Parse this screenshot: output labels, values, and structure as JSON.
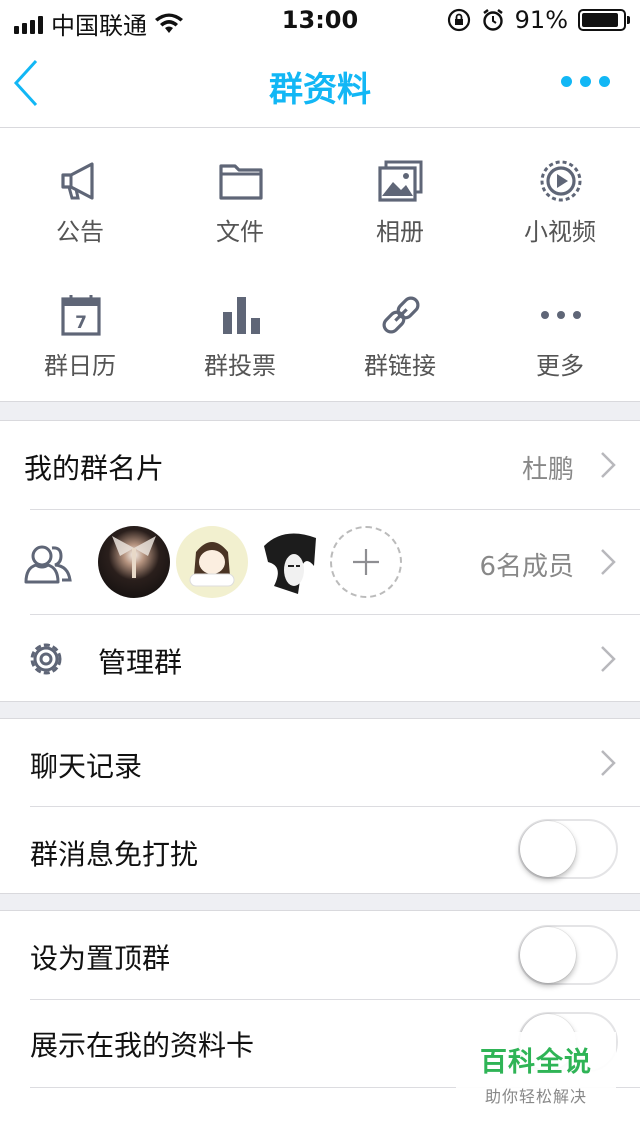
{
  "status_bar": {
    "carrier": "中国联通",
    "time": "13:00",
    "battery": "91%",
    "battery_level": 0.91
  },
  "nav": {
    "title": "群资料"
  },
  "grid": [
    {
      "label": "公告",
      "icon": "megaphone-icon"
    },
    {
      "label": "文件",
      "icon": "folder-icon"
    },
    {
      "label": "相册",
      "icon": "album-icon"
    },
    {
      "label": "小视频",
      "icon": "video-icon"
    },
    {
      "label": "群日历",
      "icon": "calendar-icon"
    },
    {
      "label": "群投票",
      "icon": "vote-icon"
    },
    {
      "label": "群链接",
      "icon": "link-icon"
    },
    {
      "label": "更多",
      "icon": "more-icon"
    }
  ],
  "calendar_day": "7",
  "card": {
    "label": "我的群名片",
    "value": "杜鹏"
  },
  "members": {
    "count_label": "6名成员"
  },
  "manage": {
    "label": "管理群"
  },
  "chat_history": {
    "label": "聊天记录"
  },
  "mute": {
    "label": "群消息免打扰",
    "enabled": false
  },
  "pin_top": {
    "label": "设为置顶群",
    "enabled": false
  },
  "show_on_card": {
    "label": "展示在我的资料卡",
    "enabled": false
  },
  "watermark": {
    "title": "百科全说",
    "subtitle": "助你轻松解决"
  },
  "colors": {
    "accent": "#12b7f5",
    "icon_gray": "#5f6677",
    "watermark_green": "#2fb456"
  }
}
